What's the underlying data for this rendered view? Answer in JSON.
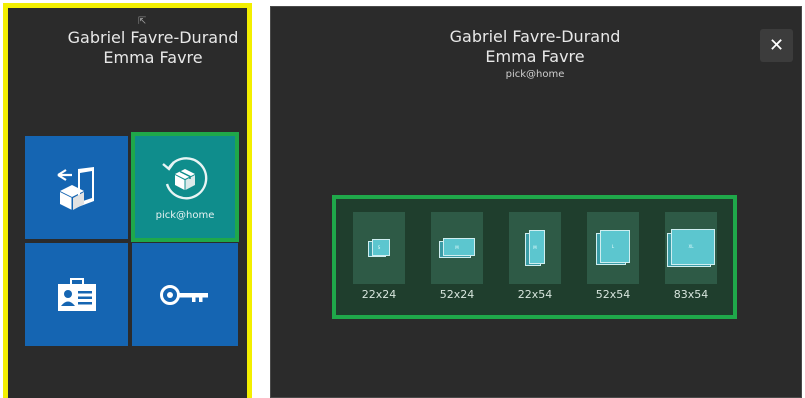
{
  "left": {
    "name_primary": "Gabriel Favre-Durand",
    "name_secondary": "Emma Favre",
    "tiles": [
      {
        "icon": "return-box-icon"
      },
      {
        "icon": "pick-at-home-icon",
        "label": "pick@home",
        "selected": true
      },
      {
        "icon": "id-card-icon"
      },
      {
        "icon": "key-icon"
      }
    ]
  },
  "right": {
    "name_primary": "Gabriel Favre-Durand",
    "name_secondary": "Emma Favre",
    "subtitle": "pick@home",
    "close_symbol": "✕",
    "formats": [
      {
        "label": "22x24",
        "icon_letter": "S"
      },
      {
        "label": "52x24",
        "icon_letter": "M"
      },
      {
        "label": "22x54",
        "icon_letter": "M"
      },
      {
        "label": "52x54",
        "icon_letter": "L"
      },
      {
        "label": "83x54",
        "icon_letter": "XL"
      }
    ]
  },
  "colors": {
    "left_border": "#f3ef00",
    "highlight": "#1fa84a",
    "tile_blue": "#1565b2",
    "tile_teal": "#0f8d8c",
    "panel_bg": "#2b2b2b"
  }
}
